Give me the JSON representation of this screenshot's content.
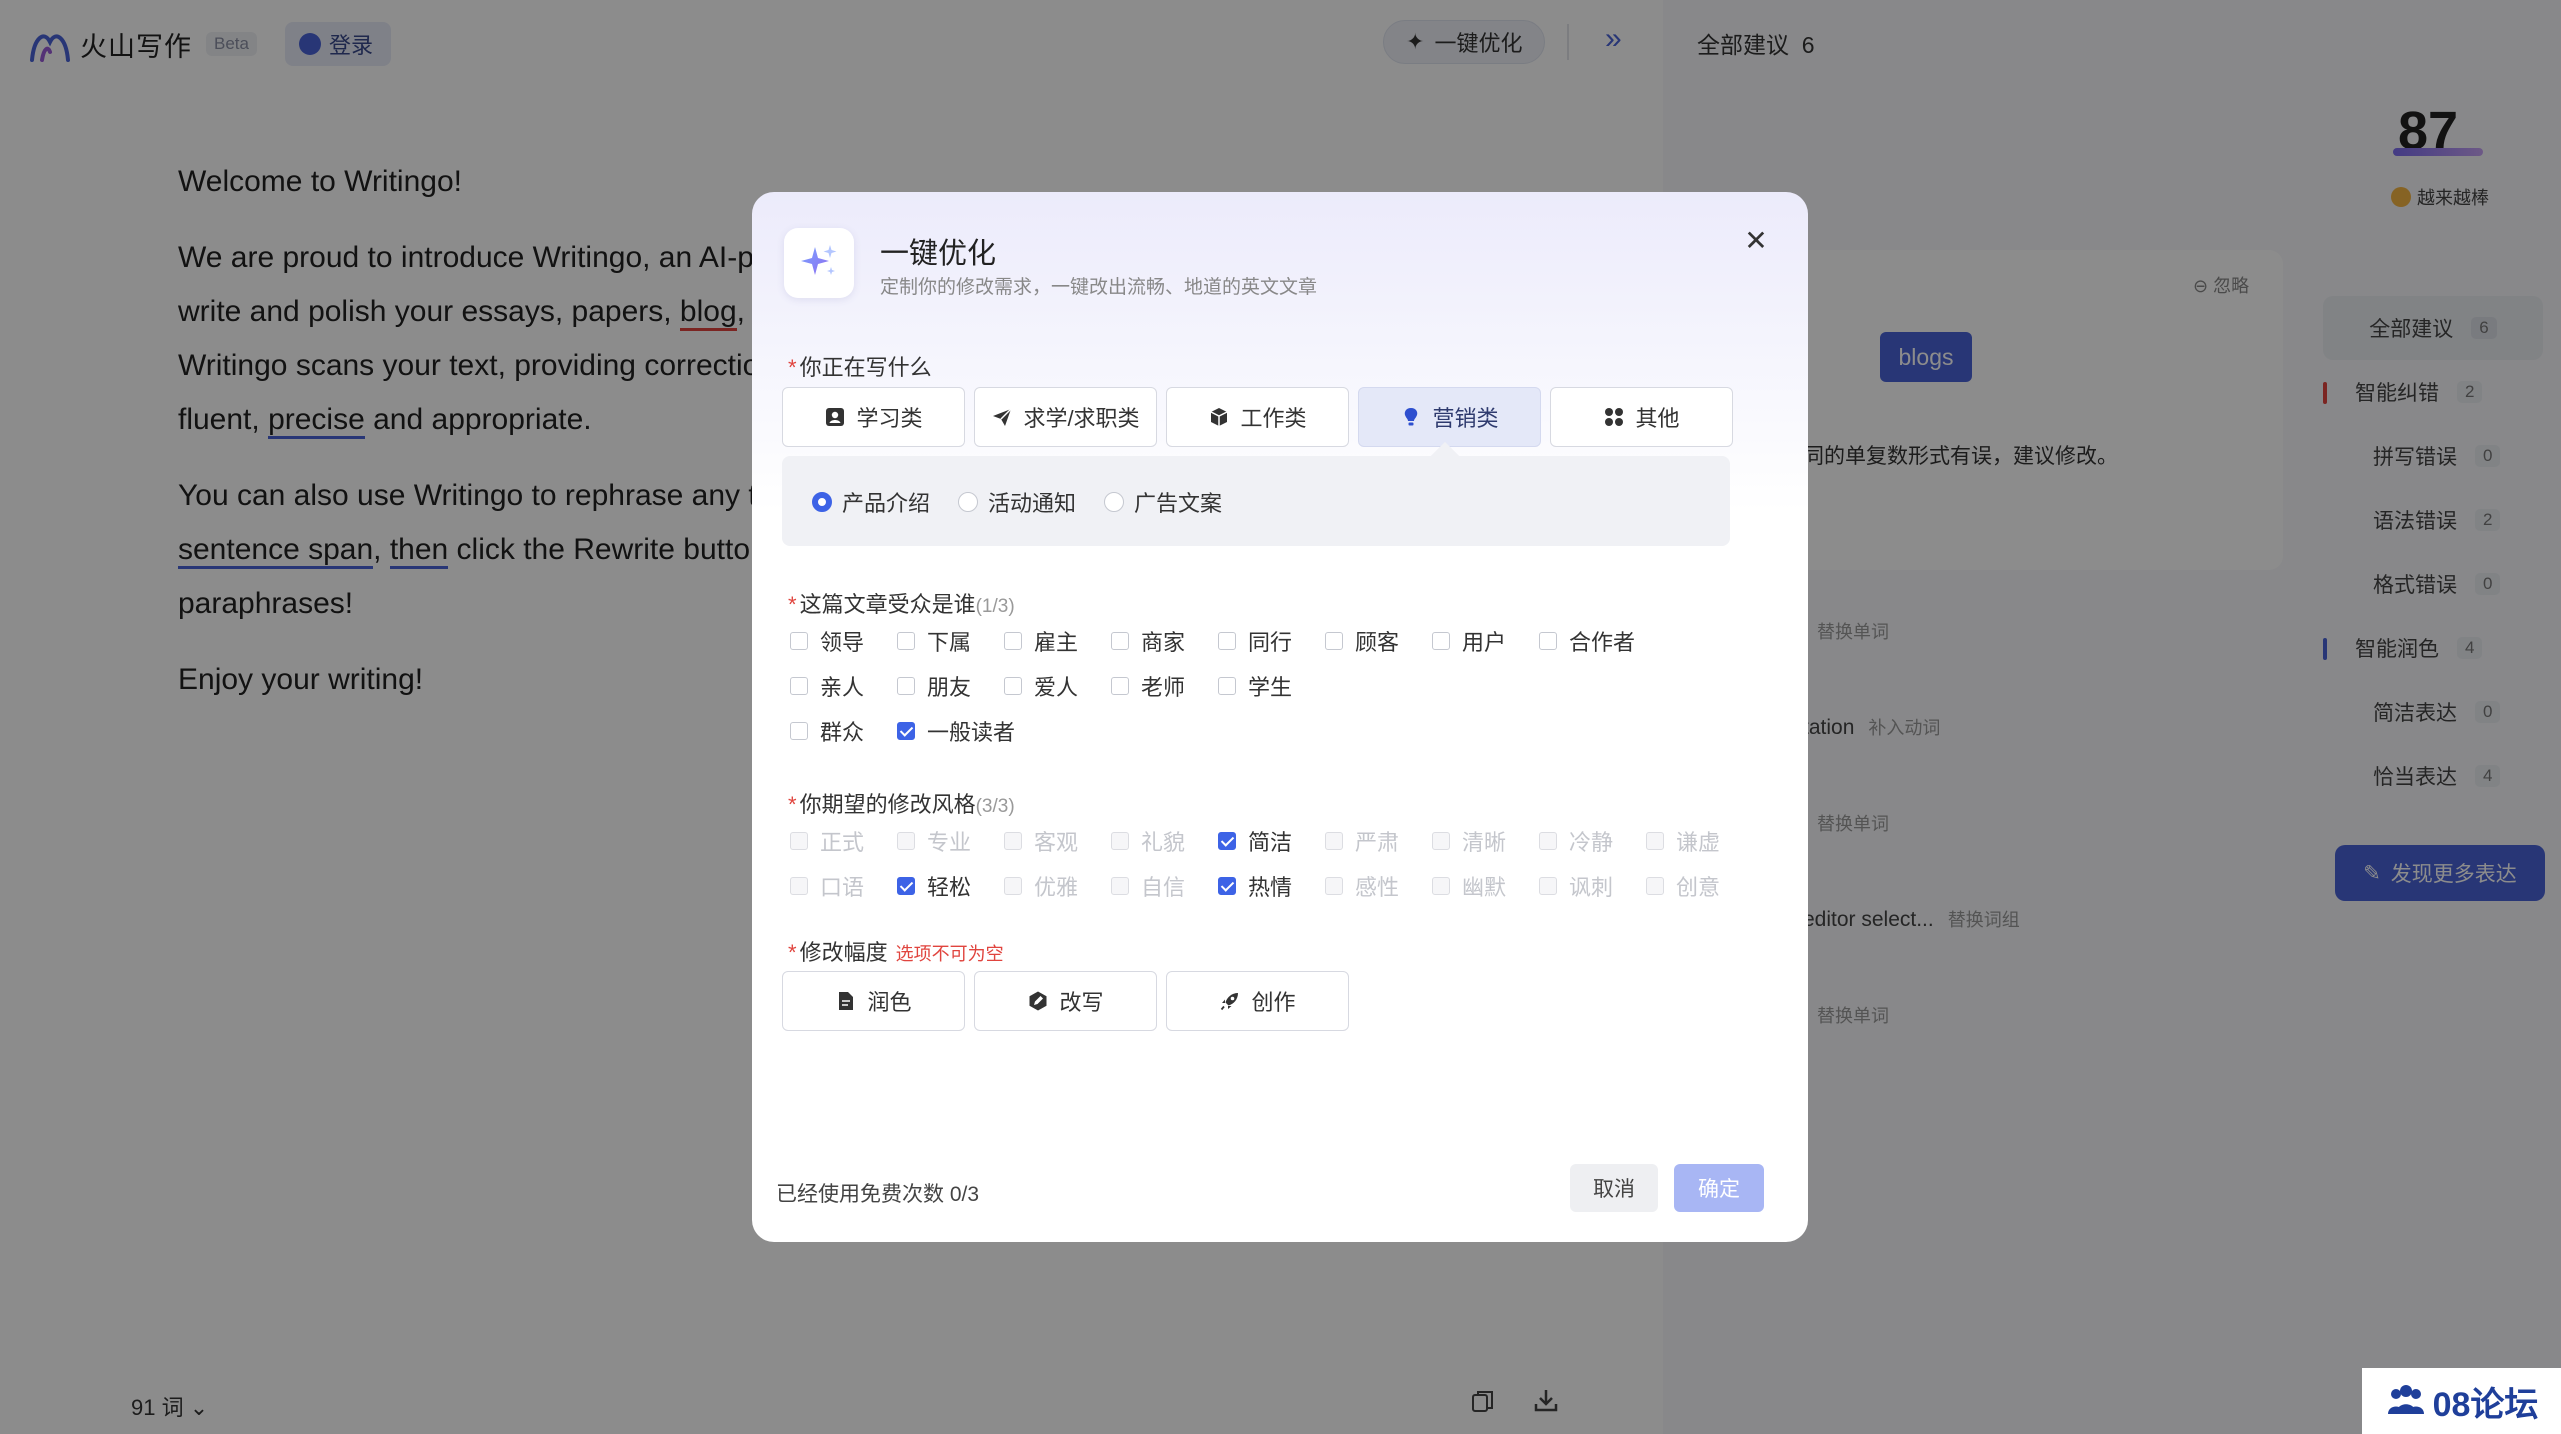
{
  "app": {
    "logo_text": "火山写作",
    "beta": "Beta",
    "login": "登录",
    "optimize": "一键优化"
  },
  "document": {
    "line1": "Welcome to Writingo!",
    "p1": [
      "We are proud to introduce Writingo, an AI-p",
      "write and polish your essays, papers, ",
      "blog",
      ",",
      "Writingo scans your text, providing correctio",
      "fluent, ",
      "precise",
      " and appropriate."
    ],
    "p2": [
      "You can also use Writingo to rephrase any t",
      "sentence span",
      ", ",
      "then",
      " click the Rewrite butto",
      "paraphrases!"
    ],
    "p3": "Enjoy your writing!",
    "word_count": "91 词"
  },
  "right_panel": {
    "all_suggestions_label": "全部建议",
    "all_suggestions_count": "6",
    "score": "87",
    "score_sub": "越来越棒",
    "card": {
      "ignore": "忽略",
      "suggestion_chip": "blogs",
      "text": "同的单复数形式有误，建议修改。"
    },
    "rows": [
      {
        "text": "",
        "tag": "替换单词"
      },
      {
        "text": "tation",
        "tag": "补入动词"
      },
      {
        "text": "",
        "tag": "替换单词"
      },
      {
        "text": "editor select...",
        "tag": "替换词组"
      },
      {
        "text": "",
        "tag": "替换单词"
      }
    ],
    "nav": [
      {
        "label": "全部建议",
        "count": "6"
      },
      {
        "label": "智能纠错",
        "count": "2"
      },
      {
        "label": "拼写错误",
        "count": "0"
      },
      {
        "label": "语法错误",
        "count": "2"
      },
      {
        "label": "格式错误",
        "count": "0"
      },
      {
        "label": "智能润色",
        "count": "4"
      },
      {
        "label": "简洁表达",
        "count": "0"
      },
      {
        "label": "恰当表达",
        "count": "4"
      }
    ],
    "more_button": "发现更多表达"
  },
  "modal": {
    "title": "一键优化",
    "subtitle": "定制你的修改需求，一键改出流畅、地道的英文文章",
    "section1": {
      "label": "你正在写什么",
      "tabs": [
        "学习类",
        "求学/求职类",
        "工作类",
        "营销类",
        "其他"
      ],
      "active_tab": "营销类",
      "sub_options": [
        "产品介绍",
        "活动通知",
        "广告文案"
      ],
      "selected_sub": "产品介绍"
    },
    "section2": {
      "label": "这篇文章受众是谁",
      "count": "(1/3)",
      "rows": [
        [
          "领导",
          "下属",
          "雇主",
          "商家",
          "同行",
          "顾客",
          "用户",
          "合作者"
        ],
        [
          "亲人",
          "朋友",
          "爱人",
          "老师",
          "学生"
        ],
        [
          "群众",
          "一般读者"
        ]
      ],
      "checked": [
        "一般读者"
      ]
    },
    "section3": {
      "label": "你期望的修改风格",
      "count": "(3/3)",
      "rows": [
        [
          "正式",
          "专业",
          "客观",
          "礼貌",
          "简洁",
          "严肃",
          "清晰",
          "冷静",
          "谦虚"
        ],
        [
          "口语",
          "轻松",
          "优雅",
          "自信",
          "热情",
          "感性",
          "幽默",
          "讽刺",
          "创意"
        ]
      ],
      "checked": [
        "简洁",
        "轻松",
        "热情"
      ]
    },
    "section4": {
      "label": "修改幅度",
      "warning": "选项不可为空",
      "options": [
        "润色",
        "改写",
        "创作"
      ]
    },
    "usage_note": "已经使用免费次数 0/3",
    "cancel": "取消",
    "confirm": "确定"
  },
  "watermark": "08论坛",
  "colors": {
    "accent": "#3d63e6",
    "brand_blue": "#4a63d8",
    "error_red": "#e0443e",
    "confirm_disabled": "#a8b6f4"
  }
}
